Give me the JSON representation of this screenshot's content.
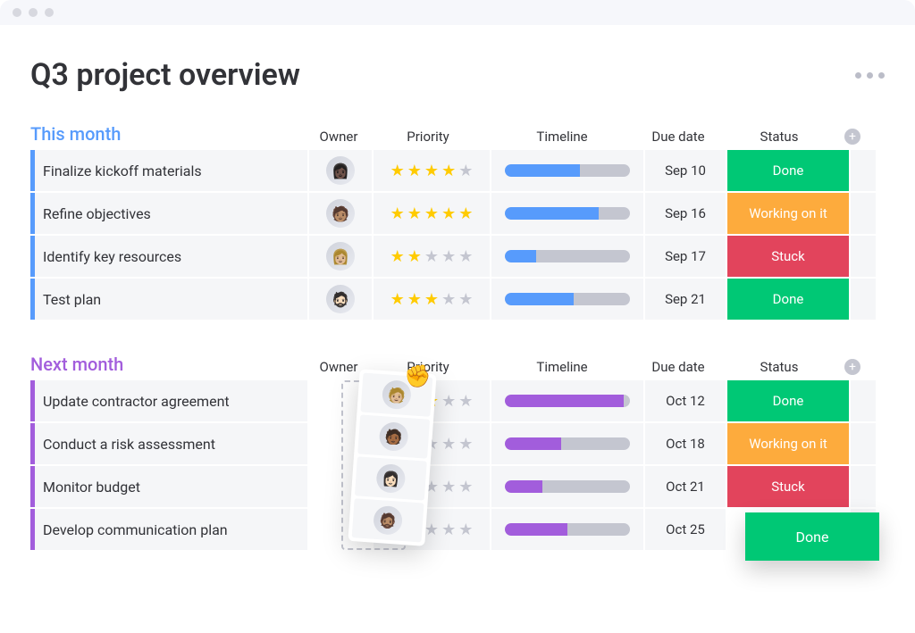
{
  "page_title": "Q3 project overview",
  "columns": {
    "owner": "Owner",
    "priority": "Priority",
    "timeline": "Timeline",
    "due_date": "Due date",
    "status": "Status"
  },
  "status_colors": {
    "Done": "#00c875",
    "Working on it": "#fdab3d",
    "Stuck": "#e2445c"
  },
  "groups": [
    {
      "title": "This month",
      "color": "#579bfc",
      "timeline_color": "#579bfc",
      "rows": [
        {
          "task": "Finalize kickoff materials",
          "owner_avatar": "👩🏿",
          "priority": 4,
          "timeline_pct": 60,
          "due_date": "Sep 10",
          "status": "Done"
        },
        {
          "task": "Refine objectives",
          "owner_avatar": "🧑🏽",
          "priority": 5,
          "timeline_pct": 75,
          "due_date": "Sep 16",
          "status": "Working on it"
        },
        {
          "task": "Identify key resources",
          "owner_avatar": "👩🏼",
          "priority": 2,
          "timeline_pct": 25,
          "due_date": "Sep 17",
          "status": "Stuck"
        },
        {
          "task": "Test plan",
          "owner_avatar": "🧔🏻",
          "priority": 3,
          "timeline_pct": 55,
          "due_date": "Sep 21",
          "status": "Done"
        }
      ]
    },
    {
      "title": "Next month",
      "color": "#a25ddc",
      "timeline_color": "#a25ddc",
      "dragging_owner_column": true,
      "rows": [
        {
          "task": "Update contractor agreement",
          "owner_avatar": "🧑🏼",
          "priority": 3,
          "timeline_pct": 95,
          "due_date": "Oct 12",
          "status": "Done"
        },
        {
          "task": "Conduct a risk assessment",
          "owner_avatar": "🧑🏾",
          "priority": 1,
          "timeline_pct": 45,
          "due_date": "Oct 18",
          "status": "Working on it"
        },
        {
          "task": "Monitor budget",
          "owner_avatar": "👩🏻",
          "priority": 0,
          "timeline_pct": 30,
          "due_date": "Oct 21",
          "status": "Stuck"
        },
        {
          "task": "Develop communication plan",
          "owner_avatar": "🧔🏽",
          "priority": 0,
          "timeline_pct": 50,
          "due_date": "Oct 25",
          "status": "Done",
          "status_floating": true
        }
      ]
    }
  ]
}
